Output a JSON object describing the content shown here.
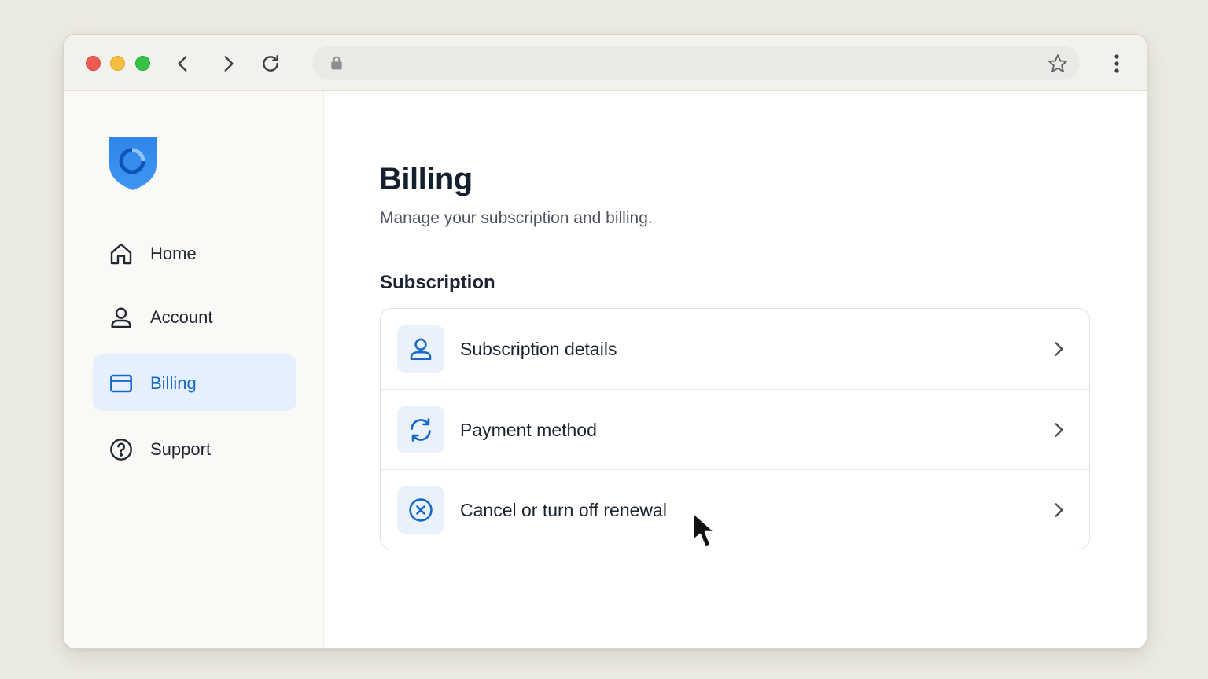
{
  "browser": {
    "controls": [
      "close",
      "minimize",
      "maximize"
    ],
    "icons": {
      "back": "chevron-left-icon",
      "forward": "chevron-right-icon",
      "reload": "reload-icon",
      "lock": "lock-icon",
      "bookmark": "star-icon",
      "menu": "kebab-menu-icon"
    }
  },
  "sidebar": {
    "logo": "shield-logo",
    "items": [
      {
        "label": "Home",
        "icon": "home-icon",
        "active": false
      },
      {
        "label": "Account",
        "icon": "user-icon",
        "active": false
      },
      {
        "label": "Billing",
        "icon": "credit-card-icon",
        "active": true
      },
      {
        "label": "Support",
        "icon": "help-circle-icon",
        "active": false
      }
    ]
  },
  "main": {
    "title": "Billing",
    "subtitle": "Manage your subscription and billing.",
    "section_title": "Subscription",
    "rows": [
      {
        "label": "Subscription details",
        "icon": "user-icon"
      },
      {
        "label": "Payment method",
        "icon": "refresh-icon"
      },
      {
        "label": "Cancel or turn off renewal",
        "icon": "x-circle-icon"
      }
    ]
  },
  "colors": {
    "accent": "#1668c9",
    "active_bg": "#e6f0fd",
    "icon_box_bg": "#e8f1fc",
    "page_bg": "#ecebe2"
  }
}
